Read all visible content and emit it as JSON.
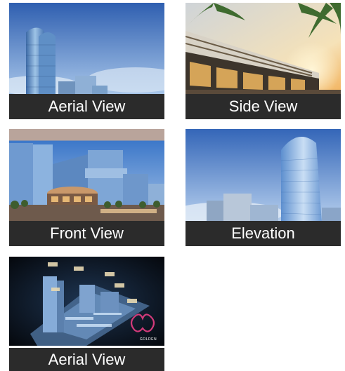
{
  "gallery": {
    "items": [
      {
        "caption": "Aerial View"
      },
      {
        "caption": "Side View"
      },
      {
        "caption": "Front View"
      },
      {
        "caption": "Elevation"
      },
      {
        "caption": "Aerial View"
      }
    ],
    "logo_text": "GOLDEN"
  },
  "colors": {
    "caption_bg": "#2b2b2b",
    "caption_text": "#ffffff",
    "sky": "#3f76c2"
  }
}
